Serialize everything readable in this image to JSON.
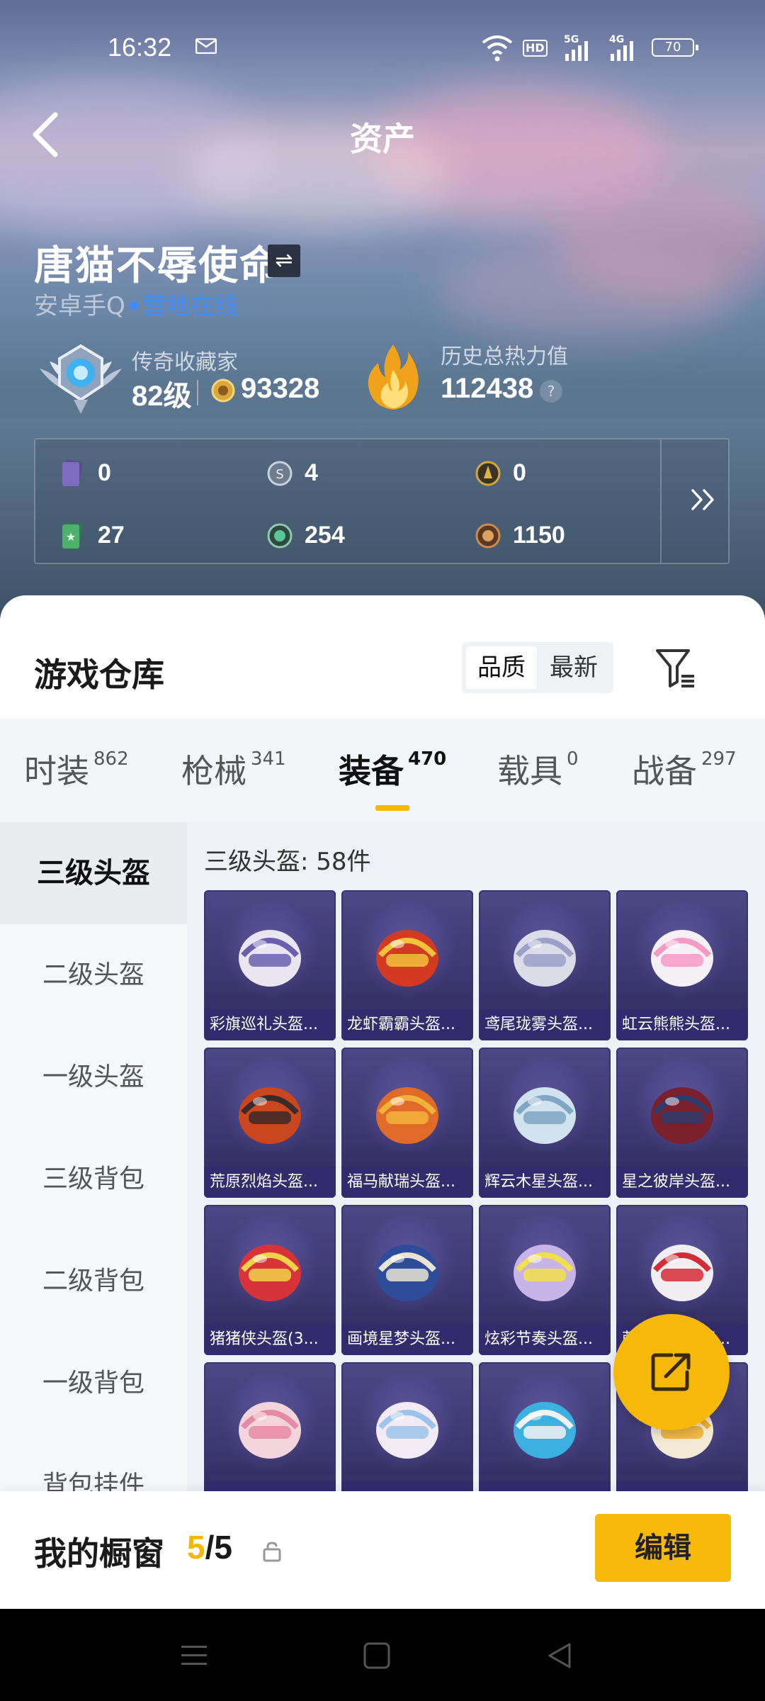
{
  "status_bar": {
    "time": "16:32",
    "hd": "HD",
    "net1": "5G",
    "net2": "4G",
    "battery": "70"
  },
  "header": {
    "title": "资产"
  },
  "user": {
    "name": "唐猫不辱使命",
    "platform": "安卓手Q",
    "online": "营地在线",
    "collector_title": "传奇收藏家",
    "level": "82级",
    "coins": "93328",
    "heat_title": "历史总热力值",
    "heat_value": "112438",
    "help": "?"
  },
  "currencies": [
    {
      "icon": "purple-card-icon",
      "value": "0"
    },
    {
      "icon": "silver-coin-icon",
      "value": "4"
    },
    {
      "icon": "gold-coin-icon",
      "value": "0"
    },
    {
      "icon": "green-card-icon",
      "value": "27"
    },
    {
      "icon": "green-token-icon",
      "value": "254"
    },
    {
      "icon": "bronze-token-icon",
      "value": "1150"
    }
  ],
  "warehouse": {
    "title": "游戏仓库",
    "sort_quality": "品质",
    "sort_latest": "最新"
  },
  "tabs": [
    {
      "label": "时装",
      "count": "862"
    },
    {
      "label": "枪械",
      "count": "341"
    },
    {
      "label": "装备",
      "count": "470",
      "active": true
    },
    {
      "label": "载具",
      "count": "0"
    },
    {
      "label": "战备",
      "count": "297"
    }
  ],
  "side_categories": [
    "三级头盔",
    "二级头盔",
    "一级头盔",
    "三级背包",
    "二级背包",
    "一级背包",
    "背包挂件"
  ],
  "grid": {
    "count_label": "三级头盔: 58件",
    "items": [
      {
        "name": "彩旗巡礼头盔...",
        "color": "#e9e6f2",
        "accent": "#6b5fb0"
      },
      {
        "name": "龙虾霸霸头盔...",
        "color": "#d23a22",
        "accent": "#f3c23c"
      },
      {
        "name": "鸢尾珑雾头盔...",
        "color": "#dcdce9",
        "accent": "#9aa0c8"
      },
      {
        "name": "虹云熊熊头盔...",
        "color": "#f4f0f6",
        "accent": "#f49ac4"
      },
      {
        "name": "荒原烈焰头盔...",
        "color": "#c9461f",
        "accent": "#3a2a2a"
      },
      {
        "name": "福马献瑞头盔...",
        "color": "#e06a28",
        "accent": "#f2b23a"
      },
      {
        "name": "辉云木星头盔...",
        "color": "#cfe2ee",
        "accent": "#7fa6c2"
      },
      {
        "name": "星之彼岸头盔...",
        "color": "#7a1f2c",
        "accent": "#2d3a6a"
      },
      {
        "name": "猪猪侠头盔(3...",
        "color": "#d9333a",
        "accent": "#f1d24a"
      },
      {
        "name": "画境星梦头盔...",
        "color": "#2f4c9a",
        "accent": "#e8e4d4"
      },
      {
        "name": "炫彩节奏头盔...",
        "color": "#c9b4e8",
        "accent": "#f2e04a"
      },
      {
        "name": "萌兔祥瑞头盔...",
        "color": "#f1eef2",
        "accent": "#d42c36"
      },
      {
        "name": "",
        "color": "#f2d4dc",
        "accent": "#e889a8"
      },
      {
        "name": "",
        "color": "#f2eaf4",
        "accent": "#9cc4ea"
      },
      {
        "name": "",
        "color": "#3cb0e0",
        "accent": "#f2f2f2"
      },
      {
        "name": "",
        "color": "#f4ead4",
        "accent": "#f0b030"
      }
    ]
  },
  "bottom": {
    "title": "我的橱窗",
    "current": "5",
    "total": "/5",
    "edit": "编辑"
  }
}
